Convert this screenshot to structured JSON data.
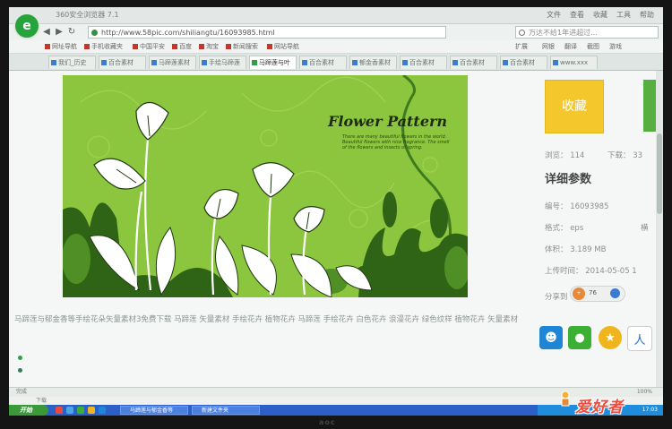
{
  "window": {
    "title": "360安全浏览器 7.1"
  },
  "menu": [
    "文件",
    "查看",
    "收藏",
    "工具",
    "帮助"
  ],
  "nav": {
    "url": "http://www.58pic.com/shiliangtu/16093985.html",
    "search_placeholder": "万达不给1年进超过..."
  },
  "favorites": [
    "网址导航",
    "手机收藏夹",
    "中国平安",
    "百度",
    "淘宝",
    "新闻搜索",
    "网站导航",
    "扩展",
    "网银",
    "翻译",
    "截图",
    "游戏"
  ],
  "tabs": [
    {
      "label": "我们_历史"
    },
    {
      "label": "百合素材"
    },
    {
      "label": "马蹄莲素材"
    },
    {
      "label": "手绘马蹄莲"
    },
    {
      "label": "马蹄莲与叶"
    },
    {
      "label": "百合素材"
    },
    {
      "label": "郁金香素材"
    },
    {
      "label": "百合素材"
    },
    {
      "label": "百合素材"
    },
    {
      "label": "百合素材"
    },
    {
      "label": "www.xxx"
    }
  ],
  "banner": {
    "title": "Flower Pattern",
    "subtitle": "There are many beautiful flowers in the world. Beautiful flowers with nice fragrance. The smell of the flowers and insects of spring."
  },
  "description": "马蹄莲与郁金香等手绘花朵矢量素材3免费下载  马蹄莲  矢量素材  手绘花卉  植物花卉  马蹄莲  手绘花卉  白色花卉  浪漫花卉  绿色纹样  植物花卉  矢量素材",
  "sidebar": {
    "collect_label": "收藏",
    "views": "浏览：  114",
    "downloads": "下载：  33",
    "params_title": "详细参数",
    "params": [
      {
        "text": "编号：  16093985"
      },
      {
        "text": "格式：  eps"
      },
      {
        "text": "体积：  3.189 MB"
      },
      {
        "text": "上传时间：  2014-05-05 1"
      }
    ],
    "format_extra": "横",
    "share_label": "分享到",
    "share_count": "76",
    "share_icons": [
      "qq-icon",
      "wechat-icon",
      "star-icon",
      "renren-icon"
    ]
  },
  "status": {
    "left": "完成",
    "right": "100%"
  },
  "download_bar": "下载",
  "taskbar": {
    "start": "开始",
    "tasks": [
      "马蹄莲与郁金香等",
      "新建文件夹"
    ],
    "time": "17:03"
  },
  "watermark": "爱好者",
  "monitor_brand": "aoc"
}
